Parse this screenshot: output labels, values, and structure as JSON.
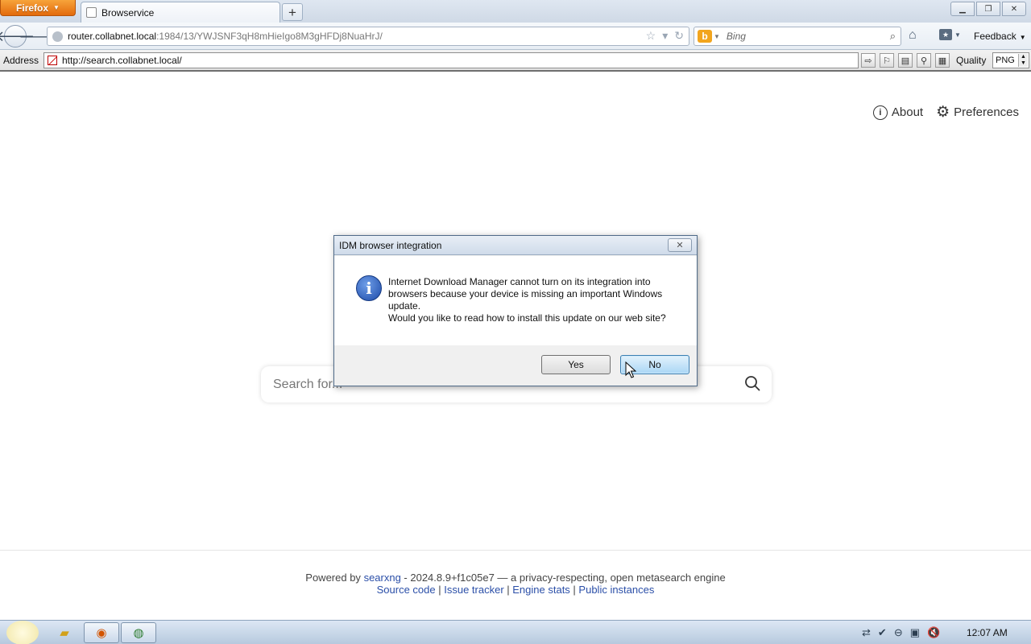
{
  "browser": {
    "app_button": "Firefox",
    "tab_title": "Browservice",
    "new_tab_symbol": "+",
    "url_host": "router.collabnet.local",
    "url_rest": ":1984/13/YWJSNF3qH8mHieIgo8M3gHFDj8NuaHrJ/",
    "search_engine": "Bing",
    "feedback_label": "Feedback"
  },
  "browservice": {
    "address_label": "Address",
    "address_value": "http://search.collabnet.local/",
    "quality_label": "Quality",
    "quality_value": "PNG"
  },
  "page": {
    "about_label": "About",
    "preferences_label": "Preferences",
    "search_placeholder": "Search for...",
    "footer": {
      "powered_by": "Powered by",
      "searxng": "searxng",
      "version_text": " - 2024.8.9+f1c05e7 — a privacy-respecting, open metasearch engine",
      "source_code": "Source code",
      "issue_tracker": "Issue tracker",
      "engine_stats": "Engine stats",
      "public_instances": "Public instances",
      "separator": " | "
    }
  },
  "dialog": {
    "title": "IDM browser integration",
    "message_line1": "Internet Download Manager cannot turn on its integration into browsers because your device is missing an important Windows update.",
    "message_line2": "Would you like to read how to install this update on our web site?",
    "yes_label": "Yes",
    "no_label": "No"
  },
  "taskbar": {
    "clock": "12:07 AM"
  },
  "colors": {
    "firefox_orange": "#e36a0c",
    "link_blue": "#2b4fa8",
    "focused_button": "#a9d6f5"
  }
}
